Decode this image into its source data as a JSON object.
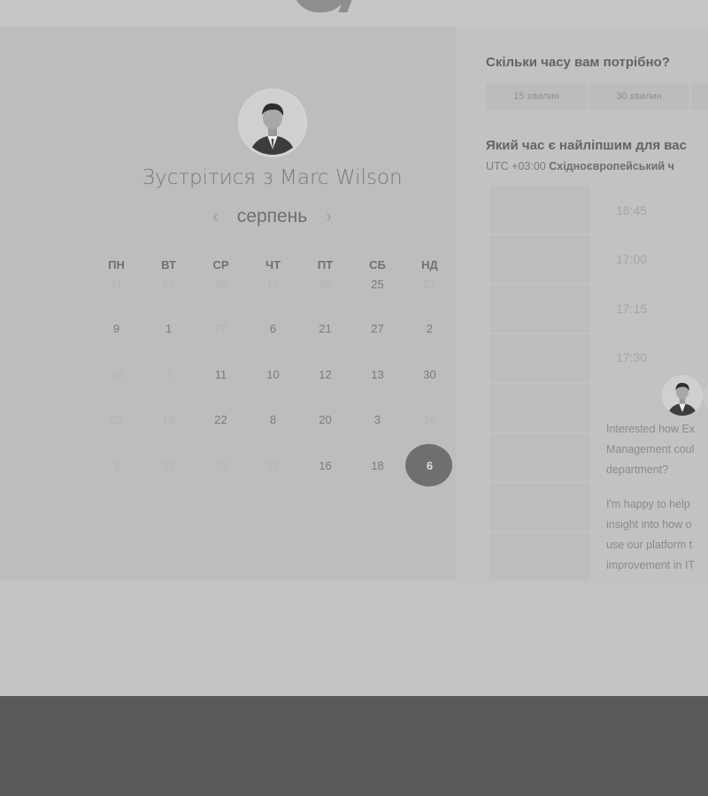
{
  "header": {
    "logo_text": ""
  },
  "calendar": {
    "title": "Зустрітися з Marc Wilson",
    "month": "серпень",
    "prev_arrow": "‹",
    "next_arrow": "›",
    "weekdays": [
      "ПН",
      "ВТ",
      "СР",
      "ЧТ",
      "ПТ",
      "СБ",
      "НД"
    ],
    "rows": [
      [
        {
          "d": "11",
          "dim": true
        },
        {
          "d": "27",
          "dim": true
        },
        {
          "d": "30",
          "dim": true
        },
        {
          "d": "12",
          "dim": true
        },
        {
          "d": "29",
          "dim": true
        },
        {
          "d": "25",
          "dim": false
        },
        {
          "d": "27",
          "dim": true
        }
      ],
      [
        {
          "d": "9",
          "dim": false
        },
        {
          "d": "1",
          "dim": false
        },
        {
          "d": "27",
          "dim": true
        },
        {
          "d": "6",
          "dim": false
        },
        {
          "d": "21",
          "dim": false
        },
        {
          "d": "27",
          "dim": false
        },
        {
          "d": "2",
          "dim": false
        }
      ],
      [
        {
          "d": "26",
          "dim": true
        },
        {
          "d": "3",
          "dim": true
        },
        {
          "d": "11",
          "dim": false
        },
        {
          "d": "10",
          "dim": false
        },
        {
          "d": "12",
          "dim": false
        },
        {
          "d": "13",
          "dim": false
        },
        {
          "d": "30",
          "dim": false
        }
      ],
      [
        {
          "d": "22",
          "dim": true
        },
        {
          "d": "14",
          "dim": true
        },
        {
          "d": "22",
          "dim": false
        },
        {
          "d": "8",
          "dim": false
        },
        {
          "d": "20",
          "dim": false
        },
        {
          "d": "3",
          "dim": false
        },
        {
          "d": "16",
          "dim": true
        }
      ],
      [
        {
          "d": "3",
          "dim": true
        },
        {
          "d": "31",
          "dim": true
        },
        {
          "d": "20",
          "dim": true
        },
        {
          "d": "12",
          "dim": true
        },
        {
          "d": "16",
          "dim": false
        },
        {
          "d": "18",
          "dim": false
        },
        {
          "d": "6",
          "dim": false,
          "selected": true
        }
      ]
    ]
  },
  "duration": {
    "question": "Скільки часу вам потрібно?",
    "options": [
      "15 хвилин",
      "30 хвилин",
      ""
    ]
  },
  "time": {
    "question": "Який час є найліпшим для вас",
    "timezone_offset": "UTC +03:00",
    "timezone_name": "Східноєвропейський ч",
    "slots": [
      "16:45",
      "17:00",
      "17:15",
      "17:30"
    ]
  },
  "host": {
    "description": "Interested how Ex\nManagement coul\ndepartment?",
    "details": "I'm happy to help\ninsight into how o\nuse our platform t\nimprovement in IT\nproductivity"
  }
}
